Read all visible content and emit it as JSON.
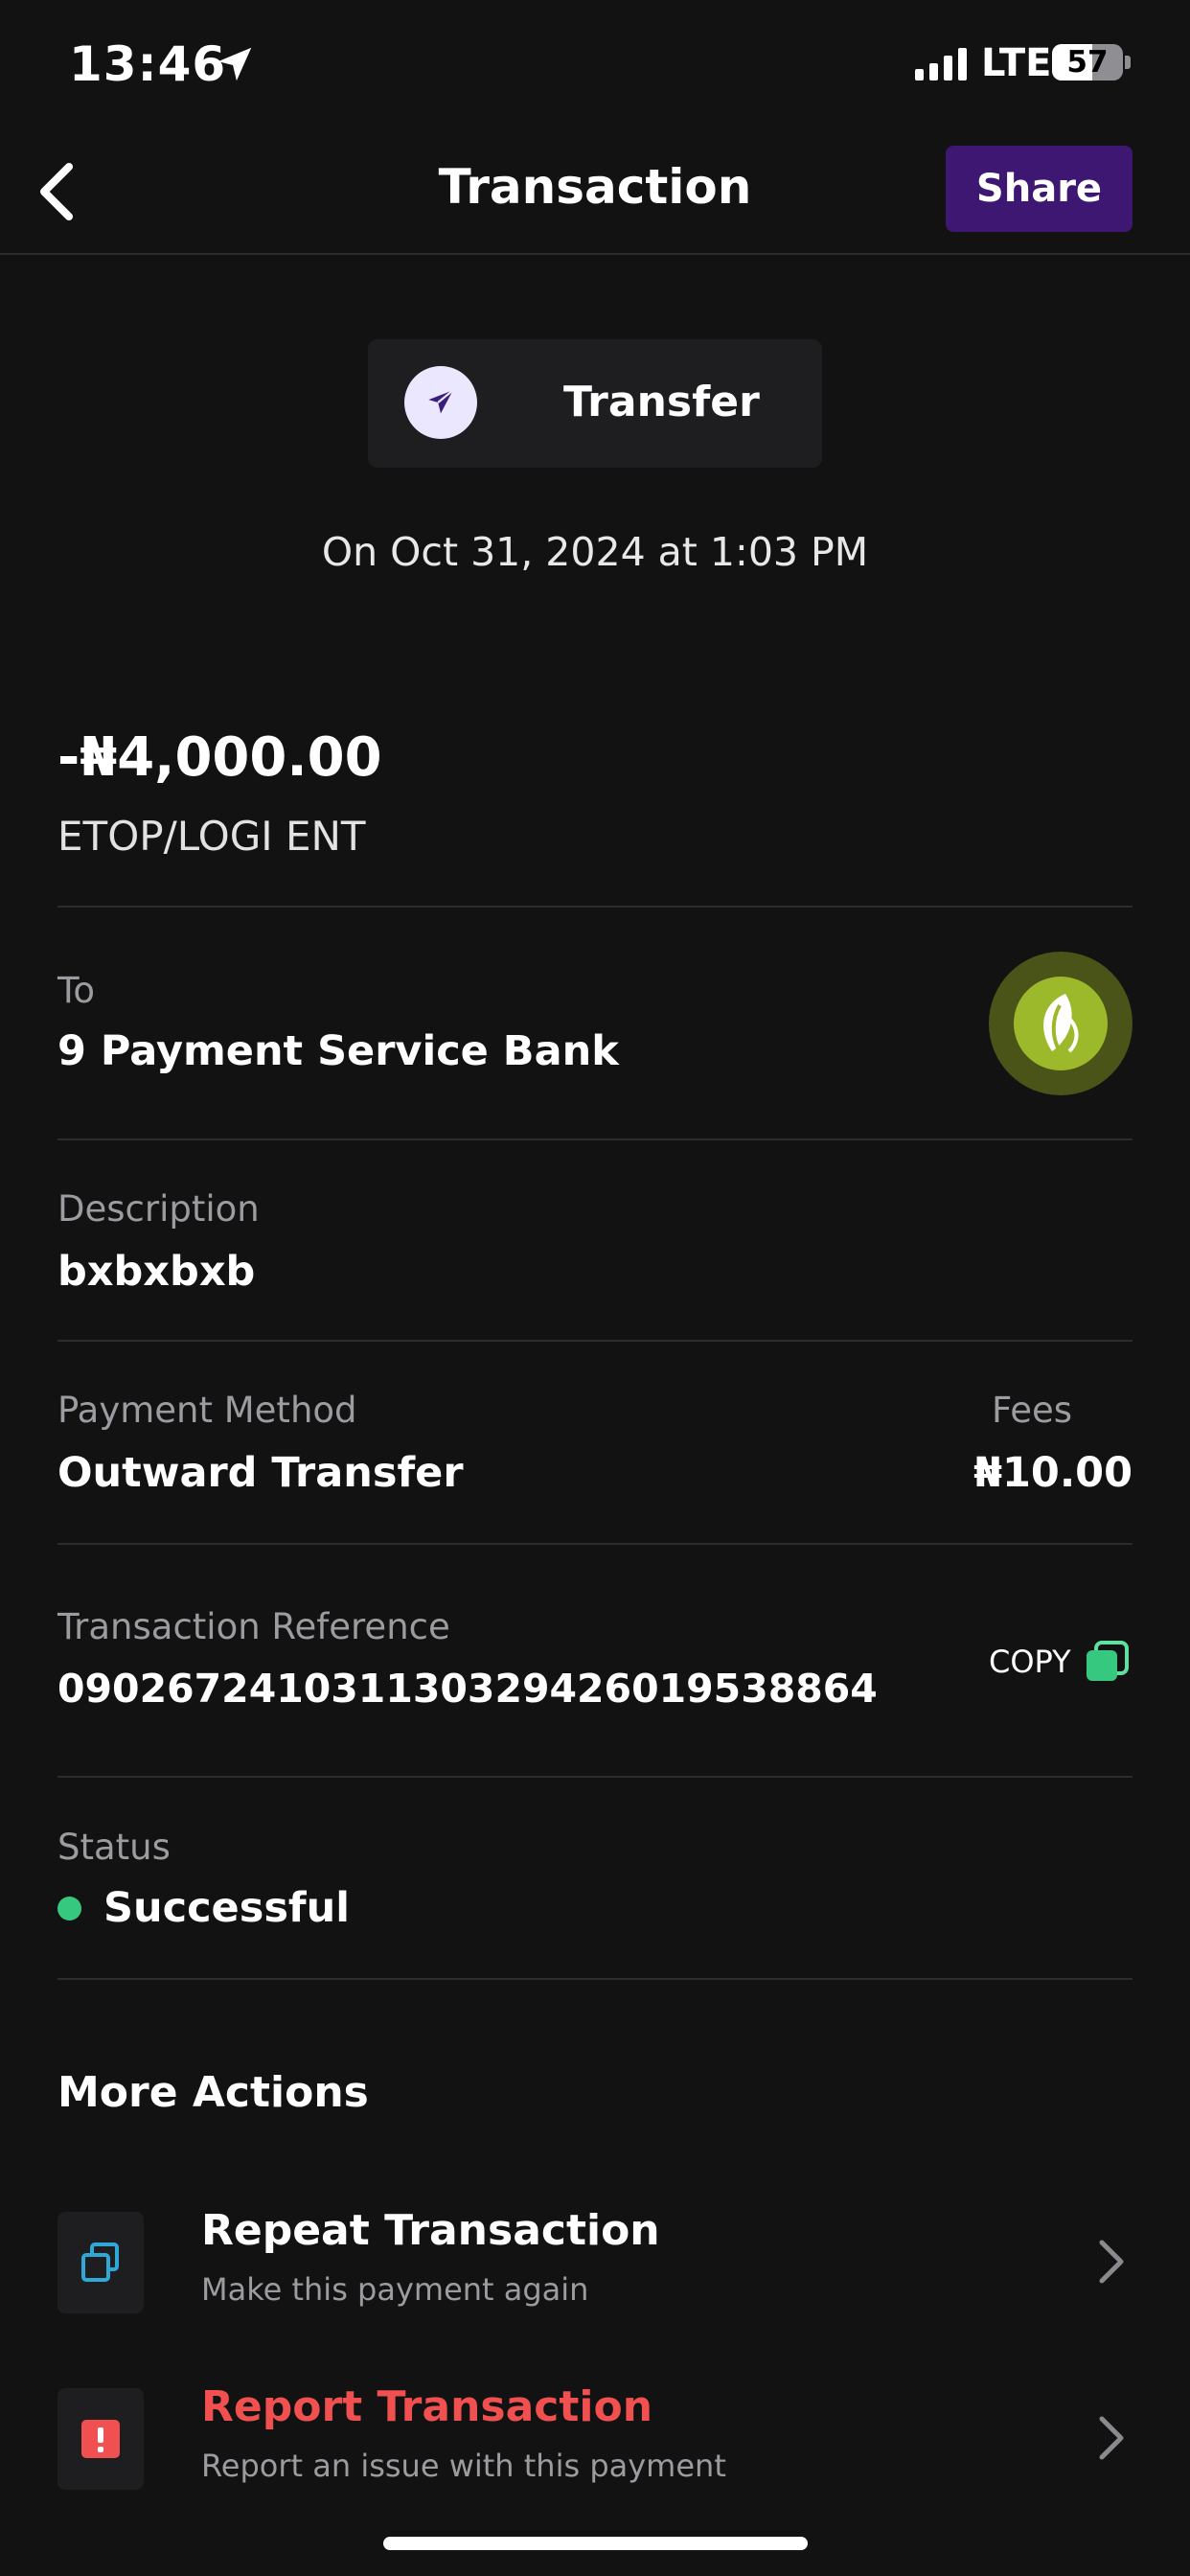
{
  "status_bar": {
    "time": "13:46",
    "network": "LTE",
    "battery": "57"
  },
  "header": {
    "title": "Transaction",
    "share_label": "Share"
  },
  "transaction": {
    "type": "Transfer",
    "date": "On Oct 31, 2024 at 1:03 PM",
    "amount": "-₦4,000.00",
    "merchant": "ETOP/LOGI ENT",
    "to_label": "To",
    "to_value": "9 Payment Service Bank",
    "description_label": "Description",
    "description_value": "bxbxbxb",
    "payment_method_label": "Payment Method",
    "payment_method_value": "Outward Transfer",
    "fees_label": "Fees",
    "fees_value": "₦10.00",
    "reference_label": "Transaction Reference",
    "reference_value": "090267241031130329426019538864",
    "copy_label": "COPY",
    "status_label": "Status",
    "status_value": "Successful"
  },
  "more_actions": {
    "title": "More Actions",
    "items": [
      {
        "title": "Repeat Transaction",
        "subtitle": "Make this payment again"
      },
      {
        "title": "Report Transaction",
        "subtitle": "Report an issue with this payment"
      }
    ]
  },
  "colors": {
    "background": "#121213",
    "accent_purple": "#3e1773",
    "success_green": "#37c880",
    "danger_red": "#f0504f",
    "repeat_icon_blue": "#2fa8d8"
  },
  "icons": {
    "location": "location-arrow-icon",
    "back": "chevron-left-icon",
    "transfer": "paper-plane-icon",
    "bank": "leaf-logo-icon",
    "copy": "copy-icon",
    "repeat": "repeat-squares-icon",
    "report": "alert-square-icon",
    "chevron": "chevron-right-icon"
  }
}
